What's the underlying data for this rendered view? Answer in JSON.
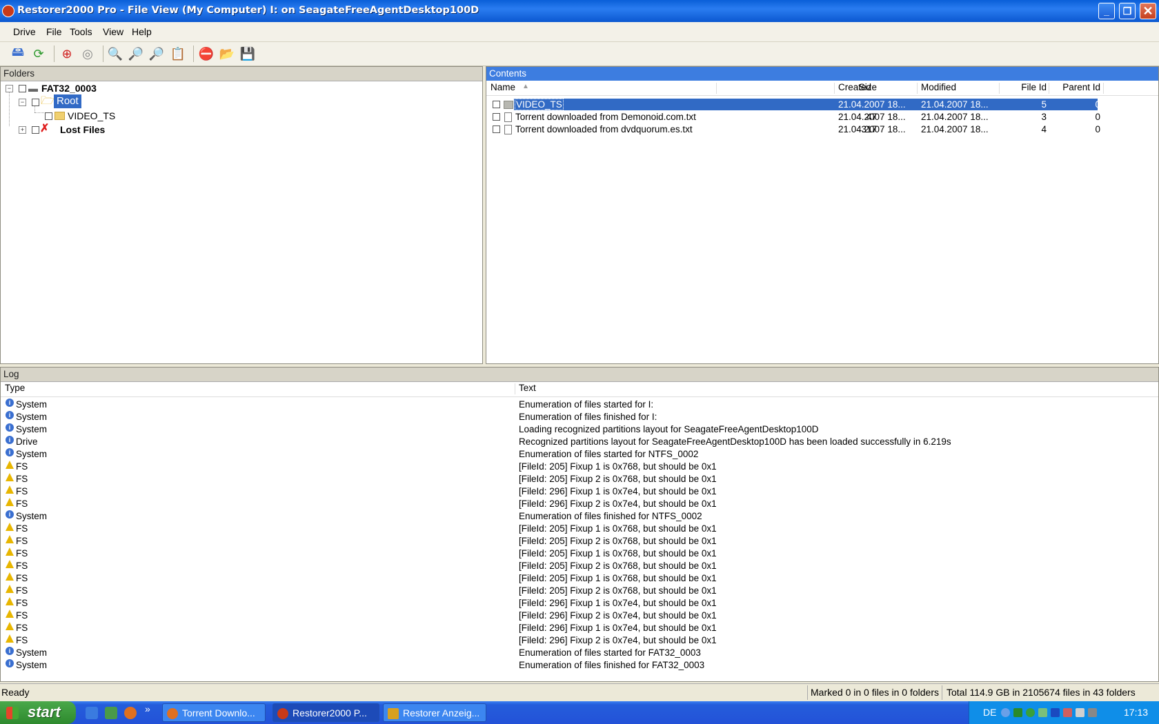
{
  "window": {
    "title": "Restorer2000 Pro - File View (My Computer) I: on SeagateFreeAgentDesktop100D"
  },
  "menu": [
    "Drive",
    "File",
    "Tools",
    "View",
    "Help"
  ],
  "folders": {
    "header": "Folders",
    "tree": [
      {
        "label": "FAT32_0003",
        "level": 0,
        "expander": "minus",
        "icon": "drive-icon",
        "bold": true
      },
      {
        "label": "Root",
        "level": 1,
        "expander": "minus",
        "icon": "folder-open-icon",
        "selected": true
      },
      {
        "label": "VIDEO_TS",
        "level": 2,
        "expander": "",
        "icon": "folder-icon"
      },
      {
        "label": "Lost Files",
        "level": 1,
        "expander": "plus",
        "icon": "lost-files-icon",
        "bold": true
      }
    ]
  },
  "contents": {
    "header": "Contents",
    "columns": {
      "name": "Name",
      "size": "Size",
      "created": "Created",
      "modified": "Modified",
      "file_id": "File Id",
      "parent_id": "Parent Id"
    },
    "rows": [
      {
        "name": "VIDEO_TS",
        "size": "",
        "created": "21.04.2007 18...",
        "modified": "21.04.2007 18...",
        "file_id": "5",
        "parent_id": "0",
        "icon": "folder-icon",
        "selected": true
      },
      {
        "name": "Torrent downloaded from Demonoid.com.txt",
        "size": "47",
        "created": "21.04.2007 18...",
        "modified": "21.04.2007 18...",
        "file_id": "3",
        "parent_id": "0",
        "icon": "text-file-icon"
      },
      {
        "name": "Torrent downloaded from dvdquorum.es.txt",
        "size": "317",
        "created": "21.04.2007 18...",
        "modified": "21.04.2007 18...",
        "file_id": "4",
        "parent_id": "0",
        "icon": "text-file-icon"
      }
    ]
  },
  "log": {
    "header": "Log",
    "columns": {
      "type": "Type",
      "text": "Text"
    },
    "rows": [
      {
        "type": "System",
        "level": "info",
        "text": "Enumeration of files started for I:"
      },
      {
        "type": "System",
        "level": "info",
        "text": "Enumeration of files finished for I:"
      },
      {
        "type": "System",
        "level": "info",
        "text": "Loading recognized partitions layout for SeagateFreeAgentDesktop100D"
      },
      {
        "type": "Drive",
        "level": "info",
        "text": "Recognized partitions layout for SeagateFreeAgentDesktop100D has been loaded successfully in 6.219s"
      },
      {
        "type": "System",
        "level": "info",
        "text": "Enumeration of files started for NTFS_0002"
      },
      {
        "type": "FS",
        "level": "warning",
        "text": "[FileId: 205] Fixup 1 is 0x768, but should be 0x1"
      },
      {
        "type": "FS",
        "level": "warning",
        "text": "[FileId: 205] Fixup 2 is 0x768, but should be 0x1"
      },
      {
        "type": "FS",
        "level": "warning",
        "text": "[FileId: 296] Fixup 1 is 0x7e4, but should be 0x1"
      },
      {
        "type": "FS",
        "level": "warning",
        "text": "[FileId: 296] Fixup 2 is 0x7e4, but should be 0x1"
      },
      {
        "type": "System",
        "level": "info",
        "text": "Enumeration of files finished for NTFS_0002"
      },
      {
        "type": "FS",
        "level": "warning",
        "text": "[FileId: 205] Fixup 1 is 0x768, but should be 0x1"
      },
      {
        "type": "FS",
        "level": "warning",
        "text": "[FileId: 205] Fixup 2 is 0x768, but should be 0x1"
      },
      {
        "type": "FS",
        "level": "warning",
        "text": "[FileId: 205] Fixup 1 is 0x768, but should be 0x1"
      },
      {
        "type": "FS",
        "level": "warning",
        "text": "[FileId: 205] Fixup 2 is 0x768, but should be 0x1"
      },
      {
        "type": "FS",
        "level": "warning",
        "text": "[FileId: 205] Fixup 1 is 0x768, but should be 0x1"
      },
      {
        "type": "FS",
        "level": "warning",
        "text": "[FileId: 205] Fixup 2 is 0x768, but should be 0x1"
      },
      {
        "type": "FS",
        "level": "warning",
        "text": "[FileId: 296] Fixup 1 is 0x7e4, but should be 0x1"
      },
      {
        "type": "FS",
        "level": "warning",
        "text": "[FileId: 296] Fixup 2 is 0x7e4, but should be 0x1"
      },
      {
        "type": "FS",
        "level": "warning",
        "text": "[FileId: 296] Fixup 1 is 0x7e4, but should be 0x1"
      },
      {
        "type": "FS",
        "level": "warning",
        "text": "[FileId: 296] Fixup 2 is 0x7e4, but should be 0x1"
      },
      {
        "type": "System",
        "level": "info",
        "text": "Enumeration of files started for FAT32_0003"
      },
      {
        "type": "System",
        "level": "info",
        "text": "Enumeration of files finished for FAT32_0003"
      }
    ]
  },
  "status": {
    "ready": "Ready",
    "marked": "Marked 0 in 0 files in 0 folders",
    "total": "Total 114.9 GB in 2105674 files in 43 folders"
  },
  "taskbar": {
    "start": "start",
    "overflow": "»",
    "tasks": [
      {
        "label": "Torrent Downlo...",
        "icon": "firefox-icon"
      },
      {
        "label": "Restorer2000 P...",
        "icon": "restorer-icon",
        "active": true
      },
      {
        "label": "Restorer Anzeig...",
        "icon": "restorer-viewer-icon"
      }
    ],
    "language": "DE",
    "clock": "17:13"
  },
  "colors": {
    "selection": "#316ac5",
    "title_bar": "#0a5fd8",
    "taskbar": "#245ddb",
    "start_button": "#3a9a3a"
  }
}
